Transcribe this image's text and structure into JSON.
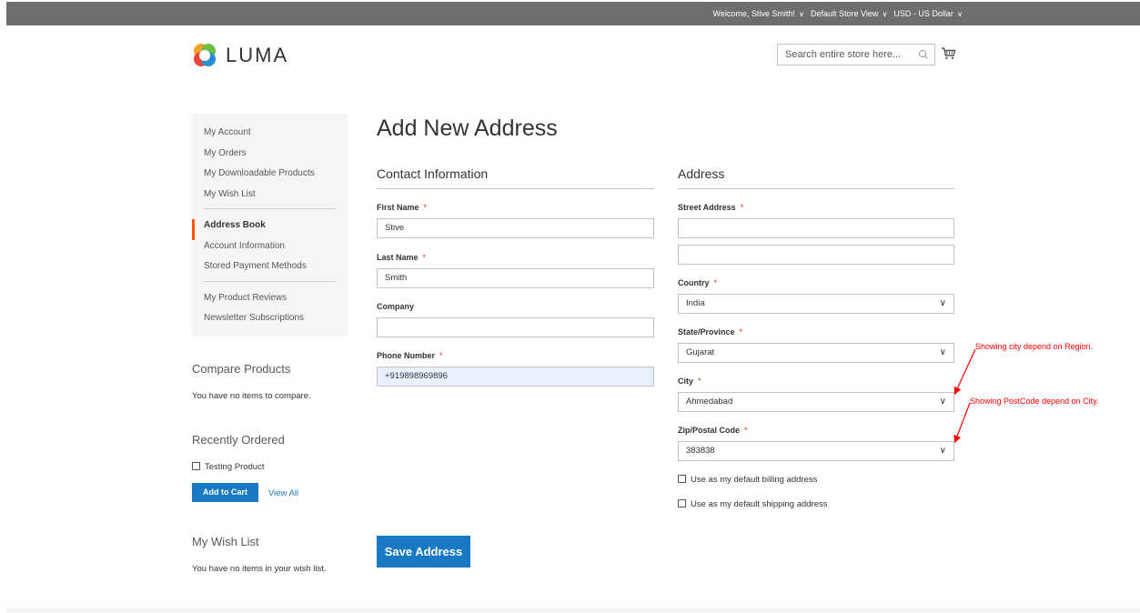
{
  "topbar": {
    "welcome": "Welcome, Stive Smith!",
    "store_view": "Default Store View",
    "currency": "USD - US Dollar"
  },
  "header": {
    "brand": "LUMA",
    "search_placeholder": "Search entire store here...",
    "search_icon": "search-icon",
    "cart_icon": "cart-icon"
  },
  "sidebar": {
    "group1": [
      "My Account",
      "My Orders",
      "My Downloadable Products",
      "My Wish List"
    ],
    "active": "Address Book",
    "group2": [
      "Account Information",
      "Stored Payment Methods"
    ],
    "group3": [
      "My Product Reviews",
      "Newsletter Subscriptions"
    ],
    "compare_title": "Compare Products",
    "compare_text": "You have no items to compare.",
    "recent_title": "Recently Ordered",
    "recent_item": "Testing Product",
    "add_to_cart": "Add to Cart",
    "view_all": "View All",
    "wishlist_title": "My Wish List",
    "wishlist_text": "You have no items in your wish list."
  },
  "page": {
    "title": "Add New Address",
    "contact_legend": "Contact Information",
    "address_legend": "Address",
    "required_mark": "*",
    "first_name_label": "First Name",
    "first_name_value": "Stive",
    "last_name_label": "Last Name",
    "last_name_value": "Smith",
    "company_label": "Company",
    "company_value": "",
    "phone_label": "Phone Number",
    "phone_value": "+919898969896",
    "street_label": "Street Address",
    "street_1": "",
    "street_2": "",
    "country_label": "Country",
    "country_value": "India",
    "state_label": "State/Province",
    "state_value": "Gujarat",
    "city_label": "City",
    "city_value": "Ahmedabad",
    "zip_label": "Zip/Postal Code",
    "zip_value": "383838",
    "default_billing": "Use as my default billing address",
    "default_shipping": "Use as my default shipping address",
    "save_button": "Save Address"
  },
  "annotations": {
    "note1": "Showing city depend on Region.",
    "note2": "Showing PostCode depend on City."
  },
  "colors": {
    "primary": "#1979c3",
    "active_accent": "#ff5501",
    "required": "#e02b27",
    "annotation": "#ff0000",
    "autofill": "#e8f0fe"
  }
}
